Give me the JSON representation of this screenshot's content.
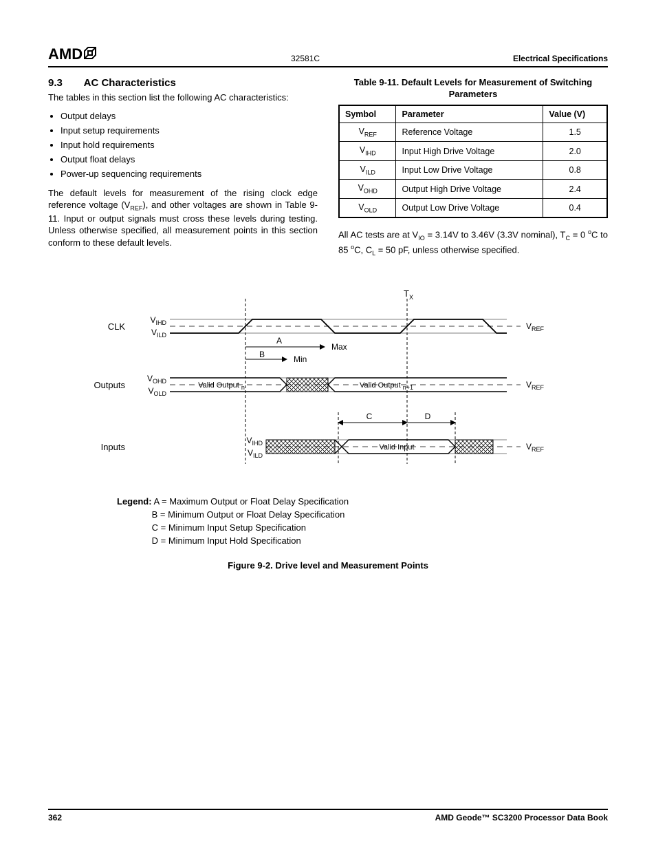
{
  "header": {
    "logo_text": "AMD",
    "doc_number": "32581C",
    "right_title": "Electrical Specifications"
  },
  "section": {
    "number": "9.3",
    "title": "AC Characteristics",
    "intro": "The tables in this section list the following AC characteristics:",
    "bullets": [
      "Output delays",
      "Input setup requirements",
      "Input hold requirements",
      "Output float delays",
      "Power-up sequencing requirements"
    ],
    "after_bullets_1": "The default levels for measurement of the rising clock edge reference voltage (V",
    "after_bullets_sub": "REF",
    "after_bullets_2": "), and other voltages are shown in Table 9-11. Input or output signals must cross these levels during testing. Unless otherwise specified, all measurement points in this section conform to these default levels."
  },
  "table": {
    "caption": "Table 9-11.  Default Levels for Measurement of Switching Parameters",
    "headers": [
      "Symbol",
      "Parameter",
      "Value (V)"
    ],
    "rows": [
      {
        "sym_base": "V",
        "sym_sub": "REF",
        "param": "Reference Voltage",
        "value": "1.5"
      },
      {
        "sym_base": "V",
        "sym_sub": "IHD",
        "param": "Input High Drive Voltage",
        "value": "2.0"
      },
      {
        "sym_base": "V",
        "sym_sub": "ILD",
        "param": "Input Low Drive Voltage",
        "value": "0.8"
      },
      {
        "sym_base": "V",
        "sym_sub": "OHD",
        "param": "Output High Drive Voltage",
        "value": "2.4"
      },
      {
        "sym_base": "V",
        "sym_sub": "OLD",
        "param": "Output Low Drive Voltage",
        "value": "0.4"
      }
    ],
    "note_1a": "All AC tests are at V",
    "note_1b": "IO",
    "note_1c": " = 3.14V to 3.46V (3.3V nominal), T",
    "note_1d": "C",
    "note_1e": " = 0 ",
    "note_1f": "o",
    "note_1g": "C to 85 ",
    "note_1h": "o",
    "note_1i": "C, C",
    "note_1j": "L",
    "note_1k": " = 50 pF, unless otherwise specified."
  },
  "diagram": {
    "tx": "T",
    "tx_sub": "X",
    "clk": "CLK",
    "vihd": "V",
    "vihd_sub": "IHD",
    "vild": "V",
    "vild_sub": "ILD",
    "vohd": "V",
    "vohd_sub": "OHD",
    "vold": "V",
    "vold_sub": "OLD",
    "vref": "V",
    "vref_sub": "REF",
    "outputs": "Outputs",
    "inputs": "Inputs",
    "valid_out_n_a": "Valid Output ",
    "valid_out_n_b": "n",
    "valid_out_np1_a": "Valid Output ",
    "valid_out_np1_b": "n+1",
    "valid_input": "Valid Input",
    "A": "A",
    "B": "B",
    "C": "C",
    "D": "D",
    "max": "Max",
    "min": "Min"
  },
  "legend": {
    "label": "Legend:",
    "lines": [
      "A = Maximum Output or Float Delay Specification",
      "B = Minimum Output or Float Delay Specification",
      "C = Minimum Input Setup Specification",
      "D = Minimum Input Hold Specification"
    ]
  },
  "figure_caption": "Figure 9-2.  Drive level and Measurement Points",
  "footer": {
    "page_num": "362",
    "book": "AMD Geode™ SC3200 Processor Data Book"
  }
}
